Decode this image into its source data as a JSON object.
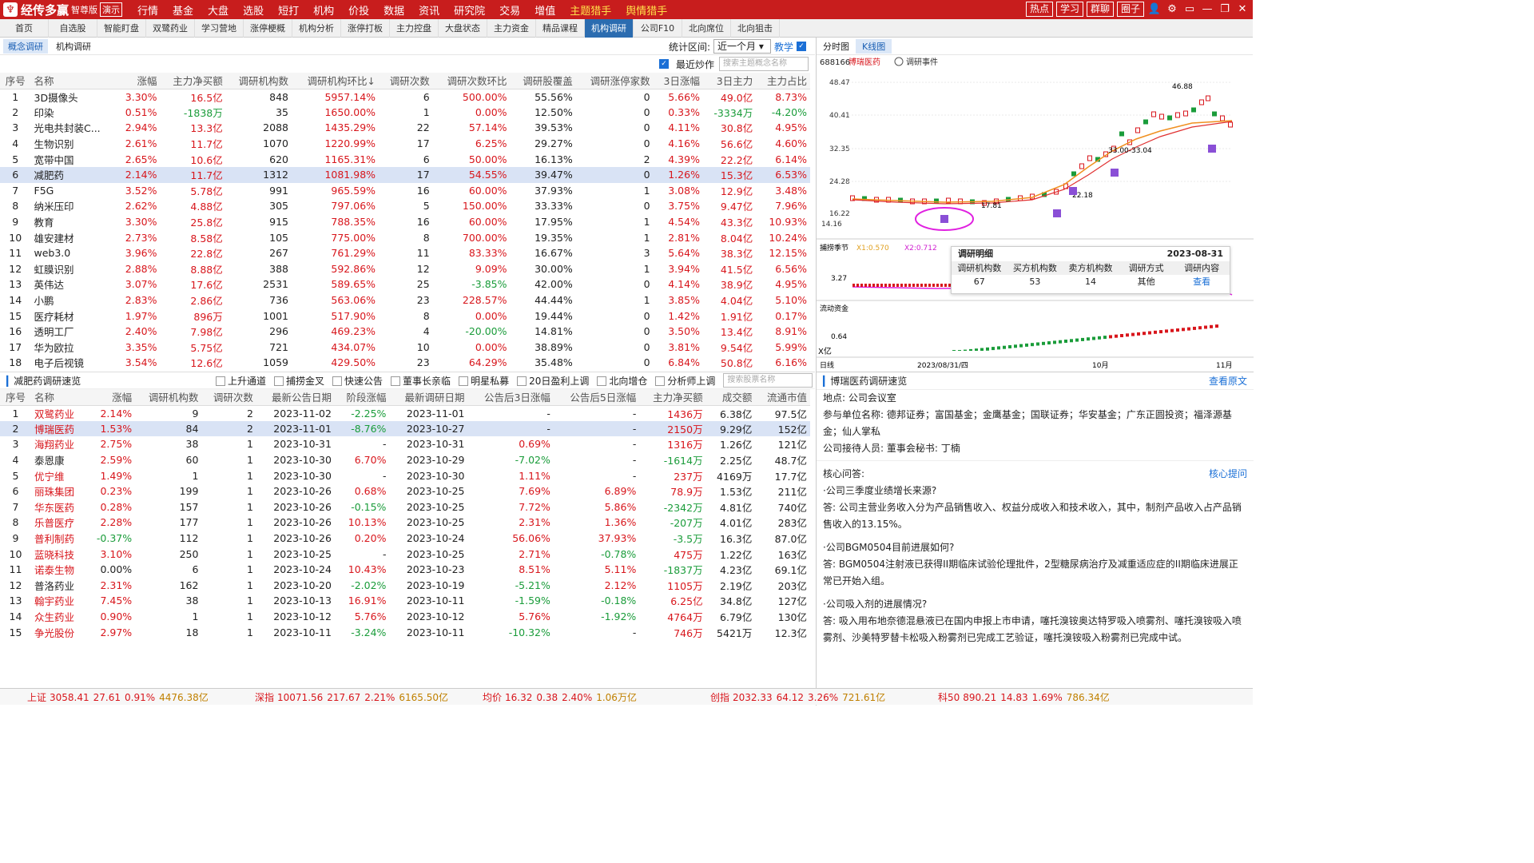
{
  "app": {
    "name": "经传多赢",
    "edition": "智尊版",
    "demo": "演示"
  },
  "menu": [
    "行情",
    "基金",
    "大盘",
    "选股",
    "短打",
    "机构",
    "价投",
    "数据",
    "资讯",
    "研究院",
    "交易",
    "增值",
    "主题猎手",
    "舆情猎手"
  ],
  "top_right": {
    "hot": "热点",
    "learn": "学习",
    "group": "群聊",
    "circle": "圈子"
  },
  "tabs": [
    "首页",
    "自选股",
    "智能盯盘",
    "双鹭药业",
    "学习营地",
    "涨停梗概",
    "机构分析",
    "涨停打板",
    "主力控盘",
    "大盘状态",
    "主力资金",
    "精品课程",
    "机构调研",
    "公司F10",
    "北向席位",
    "北向狙击"
  ],
  "zoom": "105%",
  "subtabs": [
    "概念调研",
    "机构调研"
  ],
  "filters": {
    "period_label": "统计区间:",
    "period": "近一个月",
    "teach": "教学",
    "recent": "最近炒作",
    "search_placeholder": "搜索主题概念名称"
  },
  "table1": {
    "headers": [
      "序号",
      "名称",
      "涨幅",
      "主力净买额",
      "调研机构数",
      "调研机构环比↓",
      "调研次数",
      "调研次数环比",
      "调研股覆盖",
      "调研涨停家数",
      "3日涨幅",
      "3日主力",
      "主力占比"
    ],
    "rows": [
      [
        "1",
        "3D摄像头",
        "3.30%",
        "16.5亿",
        "848",
        "5957.14%",
        "6",
        "500.00%",
        "55.56%",
        "0",
        "5.66%",
        "49.0亿",
        "8.73%"
      ],
      [
        "2",
        "印染",
        "0.51%",
        "-1838万",
        "35",
        "1650.00%",
        "1",
        "0.00%",
        "12.50%",
        "0",
        "0.33%",
        "-3334万",
        "-4.20%"
      ],
      [
        "3",
        "光电共封装C...",
        "2.94%",
        "13.3亿",
        "2088",
        "1435.29%",
        "22",
        "57.14%",
        "39.53%",
        "0",
        "4.11%",
        "30.8亿",
        "4.95%"
      ],
      [
        "4",
        "生物识别",
        "2.61%",
        "11.7亿",
        "1070",
        "1220.99%",
        "17",
        "6.25%",
        "29.27%",
        "0",
        "4.16%",
        "56.6亿",
        "4.60%"
      ],
      [
        "5",
        "宽带中国",
        "2.65%",
        "10.6亿",
        "620",
        "1165.31%",
        "6",
        "50.00%",
        "16.13%",
        "2",
        "4.39%",
        "22.2亿",
        "6.14%"
      ],
      [
        "6",
        "减肥药",
        "2.14%",
        "11.7亿",
        "1312",
        "1081.98%",
        "17",
        "54.55%",
        "39.47%",
        "0",
        "1.26%",
        "15.3亿",
        "6.53%"
      ],
      [
        "7",
        "F5G",
        "3.52%",
        "5.78亿",
        "991",
        "965.59%",
        "16",
        "60.00%",
        "37.93%",
        "1",
        "3.08%",
        "12.9亿",
        "3.48%"
      ],
      [
        "8",
        "纳米压印",
        "2.62%",
        "4.88亿",
        "305",
        "797.06%",
        "5",
        "150.00%",
        "33.33%",
        "0",
        "3.75%",
        "9.47亿",
        "7.96%"
      ],
      [
        "9",
        "教育",
        "3.30%",
        "25.8亿",
        "915",
        "788.35%",
        "16",
        "60.00%",
        "17.95%",
        "1",
        "4.54%",
        "43.3亿",
        "10.93%"
      ],
      [
        "10",
        "雄安建材",
        "2.73%",
        "8.58亿",
        "105",
        "775.00%",
        "8",
        "700.00%",
        "19.35%",
        "1",
        "2.81%",
        "8.04亿",
        "10.24%"
      ],
      [
        "11",
        "web3.0",
        "3.96%",
        "22.8亿",
        "267",
        "761.29%",
        "11",
        "83.33%",
        "16.67%",
        "3",
        "5.64%",
        "38.3亿",
        "12.15%"
      ],
      [
        "12",
        "虹膜识别",
        "2.88%",
        "8.88亿",
        "388",
        "592.86%",
        "12",
        "9.09%",
        "30.00%",
        "1",
        "3.94%",
        "41.5亿",
        "6.56%"
      ],
      [
        "13",
        "英伟达",
        "3.07%",
        "17.6亿",
        "2531",
        "589.65%",
        "25",
        "-3.85%",
        "42.00%",
        "0",
        "4.14%",
        "38.9亿",
        "4.95%"
      ],
      [
        "14",
        "小鹏",
        "2.83%",
        "2.86亿",
        "736",
        "563.06%",
        "23",
        "228.57%",
        "44.44%",
        "1",
        "3.85%",
        "4.04亿",
        "5.10%"
      ],
      [
        "15",
        "医疗耗材",
        "1.97%",
        "896万",
        "1001",
        "517.90%",
        "8",
        "0.00%",
        "19.44%",
        "0",
        "1.42%",
        "1.91亿",
        "0.17%"
      ],
      [
        "16",
        "透明工厂",
        "2.40%",
        "7.98亿",
        "296",
        "469.23%",
        "4",
        "-20.00%",
        "14.81%",
        "0",
        "3.50%",
        "13.4亿",
        "8.91%"
      ],
      [
        "17",
        "华为欧拉",
        "3.35%",
        "5.75亿",
        "721",
        "434.07%",
        "10",
        "0.00%",
        "38.89%",
        "0",
        "3.81%",
        "9.54亿",
        "5.99%"
      ],
      [
        "18",
        "电子后视镜",
        "3.54%",
        "12.6亿",
        "1059",
        "429.50%",
        "23",
        "64.29%",
        "35.48%",
        "0",
        "6.84%",
        "50.8亿",
        "6.16%"
      ]
    ]
  },
  "section2": {
    "title": "减肥药调研速览",
    "checks": [
      "上升通道",
      "捕捞金叉",
      "快速公告",
      "董事长亲临",
      "明星私募",
      "20日盈利上调",
      "北向增仓",
      "分析师上调"
    ],
    "search_placeholder": "搜索股票名称"
  },
  "table2": {
    "headers": [
      "序号",
      "名称",
      "涨幅",
      "调研机构数",
      "调研次数",
      "最新公告日期",
      "阶段涨幅",
      "最新调研日期",
      "公告后3日涨幅",
      "公告后5日涨幅",
      "主力净买额",
      "成交额",
      "流通市值"
    ],
    "rows": [
      [
        "1",
        "双鹭药业",
        "2.14%",
        "9",
        "2",
        "2023-11-02",
        "-2.25%",
        "2023-11-01",
        "-",
        "-",
        "1436万",
        "6.38亿",
        "97.5亿"
      ],
      [
        "2",
        "博瑞医药",
        "1.53%",
        "84",
        "2",
        "2023-11-01",
        "-8.76%",
        "2023-10-27",
        "-",
        "-",
        "2150万",
        "9.29亿",
        "152亿"
      ],
      [
        "3",
        "海翔药业",
        "2.75%",
        "38",
        "1",
        "2023-10-31",
        "-",
        "2023-10-31",
        "0.69%",
        "-",
        "1316万",
        "1.26亿",
        "121亿"
      ],
      [
        "4",
        "泰恩康",
        "2.59%",
        "60",
        "1",
        "2023-10-30",
        "6.70%",
        "2023-10-29",
        "-7.02%",
        "-",
        "-1614万",
        "2.25亿",
        "48.7亿"
      ],
      [
        "5",
        "优宁维",
        "1.49%",
        "1",
        "1",
        "2023-10-30",
        "-",
        "2023-10-30",
        "1.11%",
        "-",
        "237万",
        "4169万",
        "17.7亿"
      ],
      [
        "6",
        "丽珠集团",
        "0.23%",
        "199",
        "1",
        "2023-10-26",
        "0.68%",
        "2023-10-25",
        "7.69%",
        "6.89%",
        "78.9万",
        "1.53亿",
        "211亿"
      ],
      [
        "7",
        "华东医药",
        "0.28%",
        "157",
        "1",
        "2023-10-26",
        "-0.15%",
        "2023-10-25",
        "7.72%",
        "5.86%",
        "-2342万",
        "4.81亿",
        "740亿"
      ],
      [
        "8",
        "乐普医疗",
        "2.28%",
        "177",
        "1",
        "2023-10-26",
        "10.13%",
        "2023-10-25",
        "2.31%",
        "1.36%",
        "-207万",
        "4.01亿",
        "283亿"
      ],
      [
        "9",
        "普利制药",
        "-0.37%",
        "112",
        "1",
        "2023-10-26",
        "0.20%",
        "2023-10-24",
        "56.06%",
        "37.93%",
        "-3.5万",
        "16.3亿",
        "87.0亿"
      ],
      [
        "10",
        "蓝晓科技",
        "3.10%",
        "250",
        "1",
        "2023-10-25",
        "-",
        "2023-10-25",
        "2.71%",
        "-0.78%",
        "475万",
        "1.22亿",
        "163亿"
      ],
      [
        "11",
        "诺泰生物",
        "0.00%",
        "6",
        "1",
        "2023-10-24",
        "10.43%",
        "2023-10-23",
        "8.51%",
        "5.11%",
        "-1837万",
        "4.23亿",
        "69.1亿"
      ],
      [
        "12",
        "普洛药业",
        "2.31%",
        "162",
        "1",
        "2023-10-20",
        "-2.02%",
        "2023-10-19",
        "-5.21%",
        "2.12%",
        "1105万",
        "2.19亿",
        "203亿"
      ],
      [
        "13",
        "翰宇药业",
        "7.45%",
        "38",
        "1",
        "2023-10-13",
        "16.91%",
        "2023-10-11",
        "-1.59%",
        "-0.18%",
        "6.25亿",
        "34.8亿",
        "127亿"
      ],
      [
        "14",
        "众生药业",
        "0.90%",
        "1",
        "1",
        "2023-10-12",
        "5.76%",
        "2023-10-12",
        "5.76%",
        "-1.92%",
        "4764万",
        "6.79亿",
        "130亿"
      ],
      [
        "15",
        "争光股份",
        "2.97%",
        "18",
        "1",
        "2023-10-11",
        "-3.24%",
        "2023-10-11",
        "-10.32%",
        "-",
        "746万",
        "5421万",
        "12.3亿"
      ]
    ]
  },
  "chart": {
    "tabs": [
      "分时图",
      "K线图"
    ],
    "code": "688166",
    "name": "博瑞医药",
    "event_label": "调研事件",
    "y_labels": [
      "48.47",
      "40.41",
      "32.35",
      "24.28",
      "16.22",
      "14.16"
    ],
    "annotations": [
      "46.88",
      "33.00-33.04",
      "22.18",
      "17.81"
    ],
    "indicator1": {
      "name": "捕捞季节",
      "x1": "X1:0.570",
      "x2": "X2:0.712",
      "level": "3.27"
    },
    "indicator2": {
      "name": "流动资金",
      "level": "0.64",
      "unit": "X亿"
    },
    "x_axis": [
      "日线",
      "2023/08/31/四",
      "10月",
      "11月"
    ],
    "popup": {
      "title": "调研明细",
      "date": "2023-08-31",
      "headers": [
        "调研机构数",
        "买方机构数",
        "卖方机构数",
        "调研方式",
        "调研内容"
      ],
      "values": [
        "67",
        "53",
        "14",
        "其他",
        "查看"
      ]
    }
  },
  "detail": {
    "title": "博瑞医药调研速览",
    "link": "查看原文",
    "qa_label": "核心问答:",
    "qa_link": "核心提问",
    "location": "地点: 公司会议室",
    "participants": "参与单位名称: 德邦证券；富国基金；金鹰基金；国联证券；华安基金；广东正圆投资；福泽源基金；仙人掌私",
    "receiver": "公司接待人员: 董事会秘书: 丁楠",
    "qa": [
      {
        "q": "·公司三季度业绩增长来源?",
        "a": "答: 公司主营业务收入分为产品销售收入、权益分成收入和技术收入，其中，制剂产品收入占产品销售收入的13.15%。"
      },
      {
        "q": "·公司BGM0504目前进展如何?",
        "a": "答: BGM0504注射液已获得II期临床试验伦理批件，2型糖尿病治疗及减重适应症的II期临床进展正常已开始入组。"
      },
      {
        "q": "·公司吸入剂的进展情况?",
        "a": "答: 吸入用布地奈德混悬液已在国内申报上市申请，噻托溴铵奥达特罗吸入喷雾剂、噻托溴铵吸入喷雾剂、沙美特罗替卡松吸入粉雾剂已完成工艺验证，噻托溴铵吸入粉雾剂已完成中试。"
      }
    ]
  },
  "status": [
    {
      "name": "上证",
      "value": "3058.41",
      "chg": "27.61",
      "pct": "0.91%",
      "amt": "4476.38亿"
    },
    {
      "name": "深指",
      "value": "10071.56",
      "chg": "217.67",
      "pct": "2.21%",
      "amt": "6165.50亿"
    },
    {
      "name": "均价",
      "value": "16.32",
      "chg": "0.38",
      "pct": "2.40%",
      "amt": "1.06万亿"
    },
    {
      "name": "创指",
      "value": "2032.33",
      "chg": "64.12",
      "pct": "3.26%",
      "amt": "721.61亿"
    },
    {
      "name": "科50",
      "value": "890.21",
      "chg": "14.83",
      "pct": "1.69%",
      "amt": "786.34亿"
    }
  ]
}
